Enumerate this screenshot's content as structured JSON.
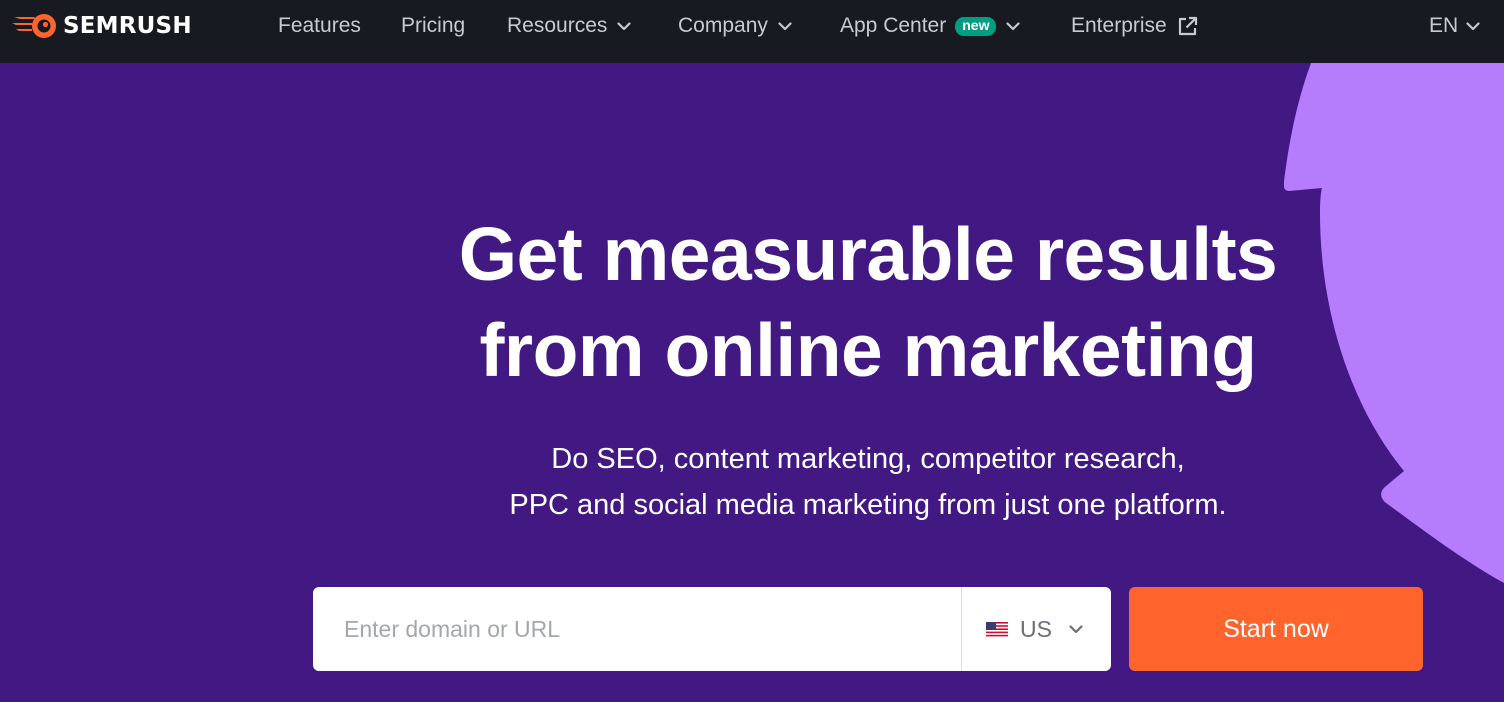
{
  "brand": {
    "name": "SEMRUSH",
    "accent": "#ff642d",
    "purple": "#421983",
    "lilac": "#b57cfc"
  },
  "nav": {
    "items": [
      {
        "label": "Features",
        "has_chevron": false
      },
      {
        "label": "Pricing",
        "has_chevron": false
      },
      {
        "label": "Resources",
        "has_chevron": true,
        "icon": "chevron-down-icon"
      },
      {
        "label": "Company",
        "has_chevron": true,
        "icon": "chevron-down-icon"
      },
      {
        "label": "App Center",
        "badge": "new",
        "has_chevron": true,
        "icon": "chevron-down-icon"
      },
      {
        "label": "Enterprise",
        "icon": "external-link-icon"
      }
    ],
    "language": "EN"
  },
  "hero": {
    "headline_line1": "Get measurable results",
    "headline_line2": "from online marketing",
    "subtitle_line1": "Do SEO, content marketing, competitor research,",
    "subtitle_line2": "PPC and social media marketing from just one platform."
  },
  "search": {
    "value": "",
    "placeholder": "Enter domain or URL",
    "country_code": "US",
    "country_flag": "us-flag-icon",
    "button_label": "Start now"
  }
}
